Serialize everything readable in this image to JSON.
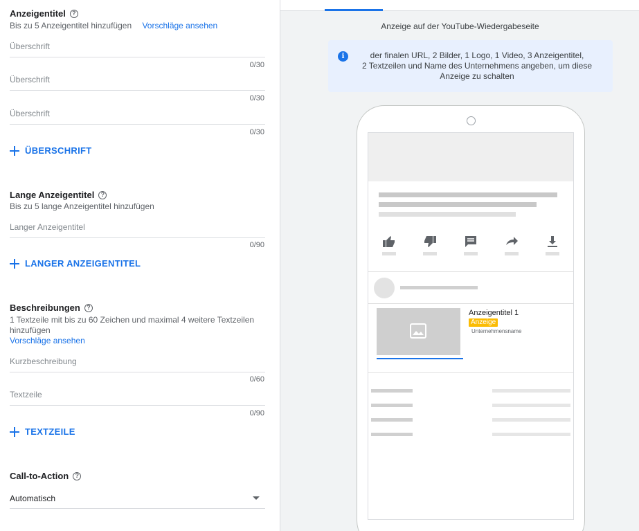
{
  "headlines": {
    "title": "Anzeigentitel",
    "help_glyph": "?",
    "subtitle": "Bis zu 5 Anzeigentitel hinzufügen",
    "suggestions_link": "Vorschläge ansehen",
    "fields": [
      {
        "placeholder": "Überschrift",
        "counter": "0/30"
      },
      {
        "placeholder": "Überschrift",
        "counter": "0/30"
      },
      {
        "placeholder": "Überschrift",
        "counter": "0/30"
      }
    ],
    "add_label": "ÜBERSCHRIFT"
  },
  "long_headlines": {
    "title": "Lange Anzeigentitel",
    "subtitle": "Bis zu 5 lange Anzeigentitel hinzufügen",
    "field": {
      "placeholder": "Langer Anzeigentitel",
      "counter": "0/90"
    },
    "add_label": "LANGER ANZEIGENTITEL"
  },
  "descriptions": {
    "title": "Beschreibungen",
    "subtitle_line1": "1 Textzeile mit bis zu 60 Zeichen und maximal 4 weitere Textzeilen",
    "subtitle_line2": "hinzufügen",
    "suggestions_link": "Vorschläge ansehen",
    "fields": [
      {
        "placeholder": "Kurzbeschreibung",
        "counter": "0/60"
      },
      {
        "placeholder": "Textzeile",
        "counter": "0/90"
      }
    ],
    "add_label": "TEXTZEILE"
  },
  "cta": {
    "title": "Call-to-Action",
    "value": "Automatisch"
  },
  "preview": {
    "title": "Anzeige auf der YouTube-Wiedergabeseite",
    "info_icon_glyph": "i",
    "info_line1": "der finalen URL, 2 Bilder, 1 Logo, 1 Video, 3 Anzeigentitel,",
    "info_line2": "2 Textzeilen und Name des Unternehmens angeben, um diese",
    "info_line3": "Anzeige zu schalten",
    "ad_title": "Anzeigentitel 1",
    "ad_badge": "Anzeige",
    "ad_company": "Unternehmensname"
  },
  "colors": {
    "accent": "#1a73e8",
    "badge": "#fbbc04",
    "info_bg": "#e8f0fe"
  }
}
